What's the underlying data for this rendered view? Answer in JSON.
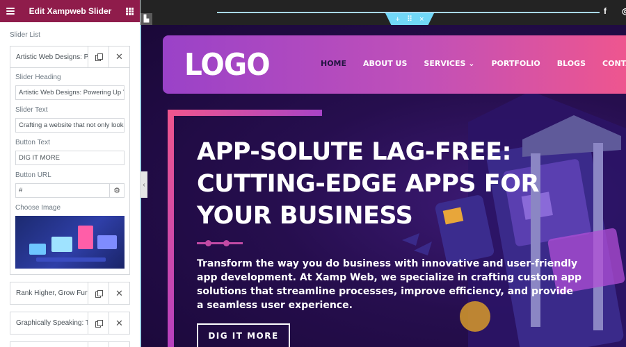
{
  "editor": {
    "title": "Edit Xampweb Slider",
    "section_label": "Slider List",
    "items": [
      {
        "title": "Artistic Web Designs: P...",
        "fields": {
          "heading_label": "Slider Heading",
          "heading_value": "Artistic Web Designs: Powering Up You",
          "text_label": "Slider Text",
          "text_value": "Crafting a website that not only looks g",
          "button_text_label": "Button Text",
          "button_text_value": "DIG IT MORE",
          "button_url_label": "Button URL",
          "button_url_value": "#",
          "image_label": "Choose Image"
        }
      },
      {
        "title": "Rank Higher, Grow Furt..."
      },
      {
        "title": "Graphically Speaking: Tr..."
      }
    ],
    "accent_color": "#8f1c4b"
  },
  "canvas": {
    "handle": {
      "add": "+",
      "move": "⠿",
      "close": "×"
    },
    "social": {
      "facebook": "f",
      "instagram": "◎"
    },
    "logo": "LOGO",
    "nav": [
      "HOME",
      "ABOUT US",
      "SERVICES ⌄",
      "PORTFOLIO",
      "BLOGS",
      "CONTACT US"
    ],
    "hero": {
      "heading": "APP-SOLUTE LAG-FREE: CUTTING-EDGE APPS FOR YOUR BUSINESS",
      "text": "Transform the way you do business with innovative and user-friendly app development. At Xamp Web, we specialize in crafting custom app solutions that streamline processes, improve efficiency, and provide a seamless user experience.",
      "button": "DIG IT MORE"
    },
    "colors": {
      "nav_gradient_start": "#9a42c8",
      "nav_gradient_end": "#f0568d",
      "hero_bg": "#260e4e",
      "handle": "#71d7f7"
    }
  }
}
